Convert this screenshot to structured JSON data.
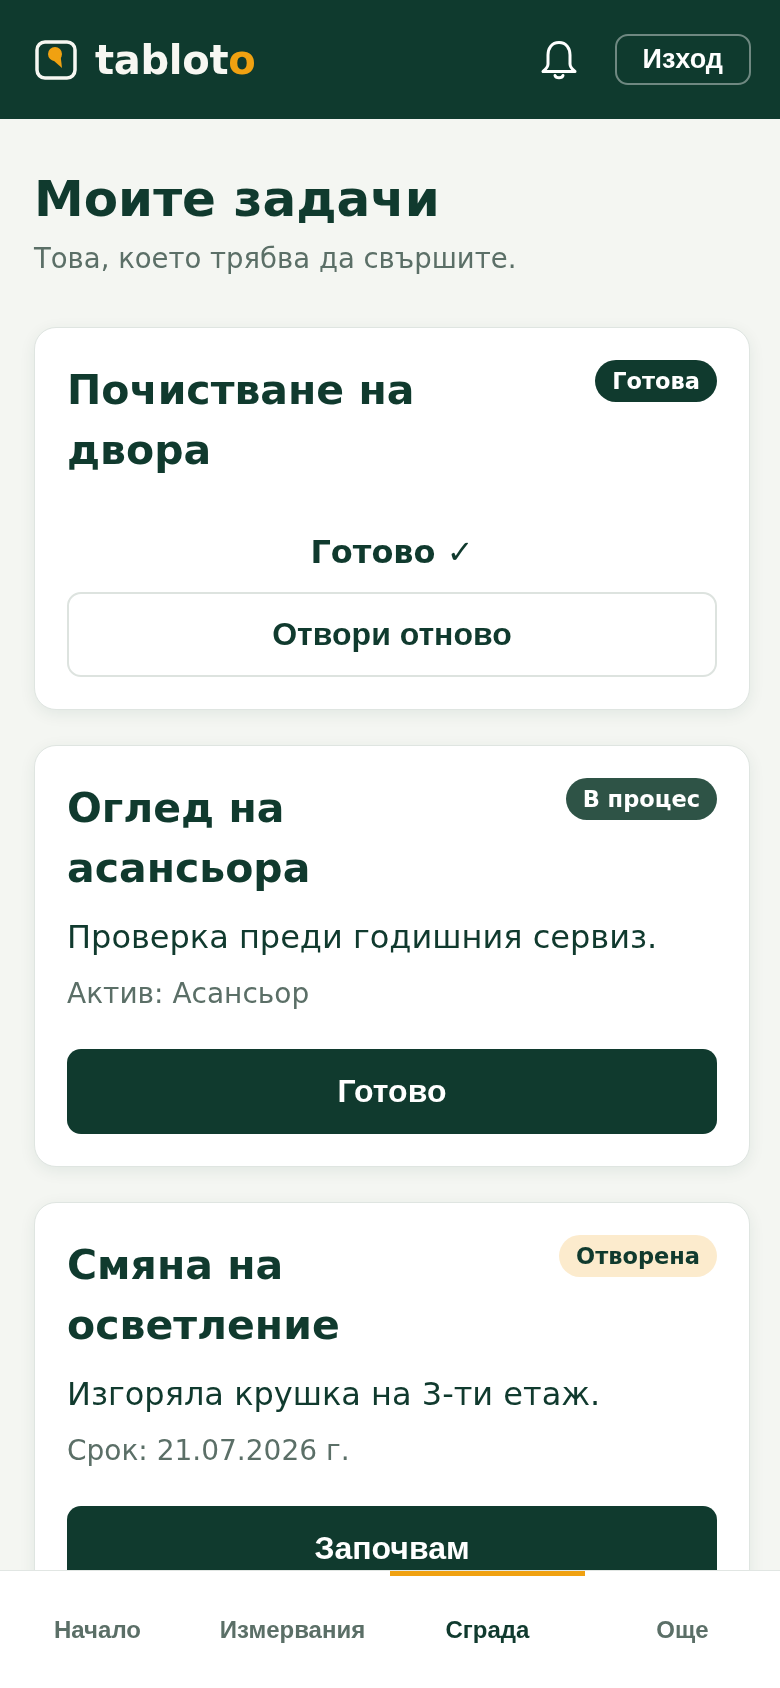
{
  "header": {
    "logo": {
      "main": "tablot",
      "accent": "o"
    },
    "logout_button": "Изход"
  },
  "page": {
    "title": "Моите задачи",
    "subtitle": "Това, което трябва да свършите."
  },
  "tasks": [
    {
      "title": "Почистване на двора",
      "status": {
        "label": "Готова",
        "kind": "done"
      },
      "done_label": "Готово ✓",
      "action": {
        "label": "Отвори отново",
        "kind": "secondary"
      }
    },
    {
      "title": "Оглед на асансьора",
      "status": {
        "label": "В процес",
        "kind": "in_progress"
      },
      "description": "Проверка преди годишния сервиз.",
      "meta": "Актив: Асансьор",
      "action": {
        "label": "Готово",
        "kind": "primary"
      }
    },
    {
      "title": "Смяна на осветление",
      "status": {
        "label": "Отворена",
        "kind": "open"
      },
      "description": "Изгоряла крушка на 3-ти етаж.",
      "meta": "Срок: 21.07.2026 г.",
      "action": {
        "label": "Започвам",
        "kind": "primary"
      }
    }
  ],
  "bottom_nav": [
    {
      "label": "Начало",
      "selected": false
    },
    {
      "label": "Измервания",
      "selected": false
    },
    {
      "label": "Сграда",
      "selected": true
    },
    {
      "label": "Още",
      "selected": false
    }
  ]
}
